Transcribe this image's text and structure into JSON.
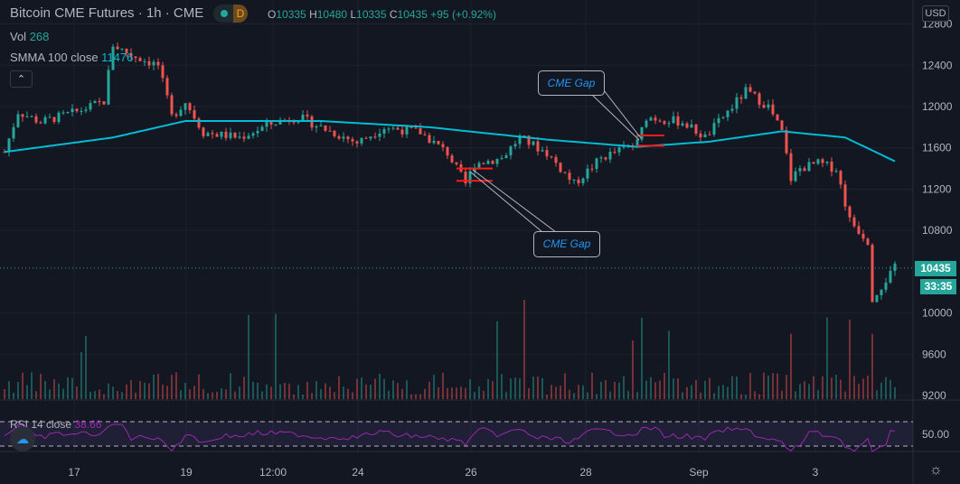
{
  "header": {
    "symbol": "Bitcoin CME Futures · 1h · CME",
    "badge": "D",
    "ohlc": {
      "o_label": "O",
      "o": "10335",
      "h_label": "H",
      "h": "10480",
      "l_label": "L",
      "l": "10335",
      "c_label": "C",
      "c": "10435",
      "change": "+95 (+0.92%)"
    }
  },
  "indicators": {
    "vol_label": "Vol",
    "vol": "268",
    "smma_label": "SMMA 100 close",
    "smma": "11476",
    "rsi_label": "RSI 14 close",
    "rsi": "38.66",
    "rsi_axis": "50.00"
  },
  "currency": "USD",
  "last_price": "10435",
  "countdown": "33:35",
  "annotations": [
    "CME Gap",
    "CME Gap"
  ],
  "colors": {
    "up": "#26a69a",
    "down": "#ef5350",
    "smma": "#00bcd4",
    "rsi": "#9c27b0",
    "gap": "#ff1a1a"
  },
  "chart_data": {
    "type": "candlestick",
    "y_ticks": [
      "12800",
      "12400",
      "12000",
      "11600",
      "11200",
      "10800",
      "10000",
      "9600",
      "9200"
    ],
    "x_ticks": [
      "17",
      "19",
      "12:00",
      "24",
      "26",
      "28",
      "Sep",
      "3"
    ],
    "price_path": [
      [
        0,
        11560
      ],
      [
        3,
        11950
      ],
      [
        8,
        11850
      ],
      [
        16,
        11950
      ],
      [
        22,
        12050
      ],
      [
        24,
        12600
      ],
      [
        28,
        12500
      ],
      [
        34,
        12400
      ],
      [
        37,
        11900
      ],
      [
        40,
        12050
      ],
      [
        44,
        11750
      ],
      [
        52,
        11700
      ],
      [
        60,
        11850
      ],
      [
        65,
        11900
      ],
      [
        70,
        11800
      ],
      [
        78,
        11650
      ],
      [
        84,
        11800
      ],
      [
        92,
        11750
      ],
      [
        98,
        11550
      ],
      [
        102,
        11250
      ],
      [
        104,
        11450
      ],
      [
        110,
        11500
      ],
      [
        114,
        11700
      ],
      [
        120,
        11550
      ],
      [
        126,
        11250
      ],
      [
        132,
        11500
      ],
      [
        140,
        11650
      ],
      [
        142,
        11900
      ],
      [
        150,
        11850
      ],
      [
        155,
        11700
      ],
      [
        160,
        11950
      ],
      [
        164,
        12150
      ],
      [
        169,
        12000
      ],
      [
        172,
        11750
      ],
      [
        174,
        11300
      ],
      [
        176,
        11400
      ],
      [
        180,
        11450
      ],
      [
        184,
        11400
      ],
      [
        187,
        10900
      ],
      [
        191,
        10700
      ],
      [
        192,
        10150
      ],
      [
        197,
        10435
      ]
    ],
    "smma_path": [
      [
        0,
        11560
      ],
      [
        24,
        11700
      ],
      [
        40,
        11860
      ],
      [
        70,
        11860
      ],
      [
        94,
        11800
      ],
      [
        120,
        11680
      ],
      [
        140,
        11610
      ],
      [
        156,
        11660
      ],
      [
        172,
        11760
      ],
      [
        186,
        11700
      ],
      [
        197,
        11470
      ]
    ],
    "gaps": [
      [
        11400,
        11280
      ],
      [
        11720,
        11620
      ]
    ]
  }
}
